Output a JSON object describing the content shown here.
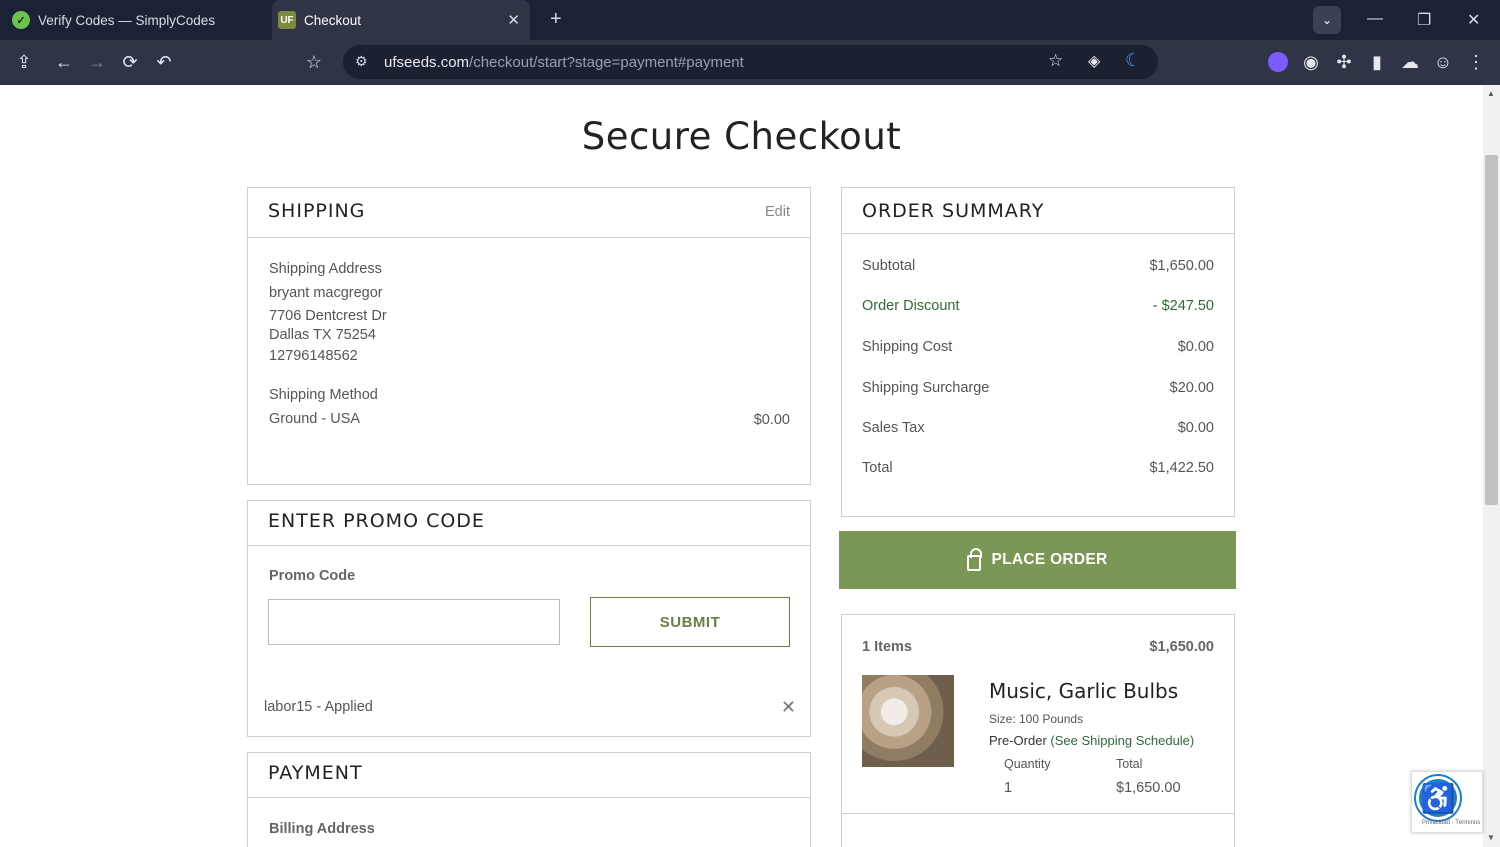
{
  "browser": {
    "tabs": [
      {
        "title": "Verify Codes — SimplyCodes",
        "favicon": "simplycodes-check-icon"
      },
      {
        "title": "Checkout",
        "favicon": "uf-logo-icon"
      }
    ],
    "url_host": "ufseeds.com",
    "url_path": "/checkout/start?stage=payment#payment"
  },
  "page": {
    "title": "Secure Checkout"
  },
  "shipping": {
    "header": "SHIPPING",
    "edit_label": "Edit",
    "address_label": "Shipping Address",
    "name": "bryant macgregor",
    "street": "7706 Dentcrest Dr",
    "city_line": "Dallas TX 75254",
    "phone": "12796148562",
    "method_label": "Shipping Method",
    "method": "Ground - USA",
    "method_cost": "$0.00"
  },
  "promo": {
    "header": "ENTER PROMO CODE",
    "field_label": "Promo Code",
    "input_value": "",
    "submit_label": "SUBMIT",
    "applied_text": "labor15 - Applied"
  },
  "payment": {
    "header": "PAYMENT",
    "billing_label": "Billing Address"
  },
  "summary": {
    "header": "ORDER SUMMARY",
    "rows": [
      {
        "label": "Subtotal",
        "value": "$1,650.00"
      },
      {
        "label": "Order Discount",
        "value": "- $247.50"
      },
      {
        "label": "Shipping Cost",
        "value": "$0.00"
      },
      {
        "label": "Shipping Surcharge",
        "value": "$20.00"
      },
      {
        "label": "Sales Tax",
        "value": "$0.00"
      },
      {
        "label": "Total",
        "value": "$1,422.50"
      }
    ],
    "place_order_label": "PLACE ORDER",
    "accent_color": "#7b9755"
  },
  "items": {
    "count_label": "1 Items",
    "count_total": "$1,650.00",
    "product": {
      "name": "Music, Garlic Bulbs",
      "size": "Size: 100 Pounds",
      "preorder": "Pre-Order",
      "schedule_link": "(See Shipping Schedule)",
      "qty_label": "Quantity",
      "total_label": "Total",
      "qty": "1",
      "total": "$1,650.00"
    }
  },
  "widget": {
    "recaptcha_text": "Privacidad - Términos"
  }
}
